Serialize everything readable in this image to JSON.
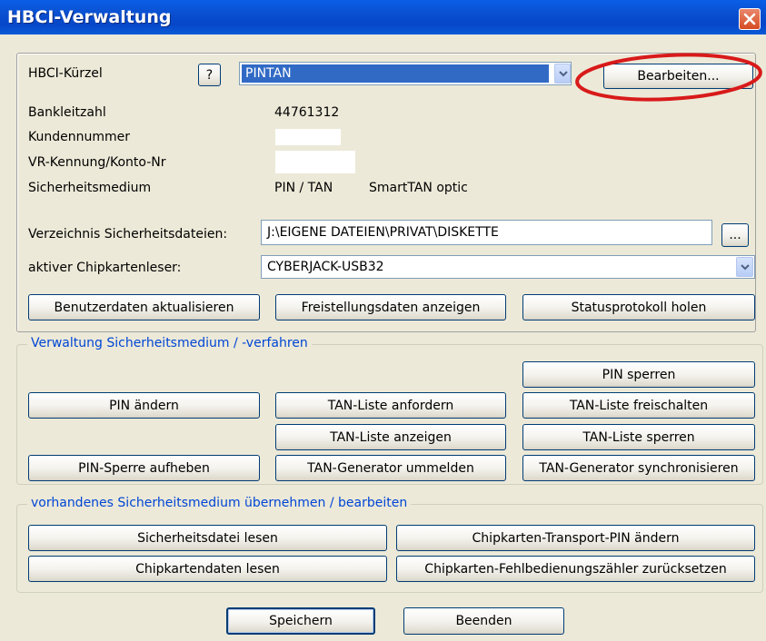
{
  "window": {
    "title": "HBCI-Verwaltung"
  },
  "top_box": {
    "kuerzel_label": "HBCI-Kürzel",
    "help_label": "?",
    "kuerzel_value": "PINTAN",
    "edit_label": "Bearbeiten...",
    "blz_label": "Bankleitzahl",
    "blz_value": "44761312",
    "kunde_label": "Kundennummer",
    "kennung_label": "VR-Kennung/Konto-Nr",
    "medium_label": "Sicherheitsmedium",
    "medium_value": "PIN / TAN",
    "medium_extra": "SmartTAN optic",
    "verz_label": "Verzeichnis Sicherheitsdateien:",
    "verz_value": "J:\\EIGENE DATEIEN\\PRIVAT\\DISKETTE",
    "browse_label": "...",
    "reader_label": "aktiver Chipkartenleser:",
    "reader_value": "CYBERJACK-USB32",
    "btn_benutzer": "Benutzerdaten aktualisieren",
    "btn_freistellung": "Freistellungsdaten anzeigen",
    "btn_status": "Statusprotokoll holen"
  },
  "group_verwaltung": {
    "title": "Verwaltung Sicherheitsmedium / -verfahren",
    "pin_sperren": "PIN sperren",
    "pin_aendern": "PIN ändern",
    "tan_anfordern": "TAN-Liste anfordern",
    "tan_freischalten": "TAN-Liste freischalten",
    "tan_anzeigen": "TAN-Liste anzeigen",
    "tan_sperren": "TAN-Liste sperren",
    "pin_sperre_aufheben": "PIN-Sperre aufheben",
    "tan_gen_ummelden": "TAN-Generator ummelden",
    "tan_gen_sync": "TAN-Generator synchronisieren"
  },
  "group_uebernehmen": {
    "title": "vorhandenes Sicherheitsmedium übernehmen / bearbeiten",
    "datei_lesen": "Sicherheitsdatei lesen",
    "transport_pin": "Chipkarten-Transport-PIN ändern",
    "karten_lesen": "Chipkartendaten lesen",
    "fehl_zaehler": "Chipkarten-Fehlbedienungszähler zurücksetzen"
  },
  "footer": {
    "save": "Speichern",
    "exit": "Beenden"
  },
  "colors": {
    "title_bar": "#0a4fd0",
    "group_title": "#0046d5",
    "annotation": "#d81a1a",
    "face": "#ece9d8"
  }
}
